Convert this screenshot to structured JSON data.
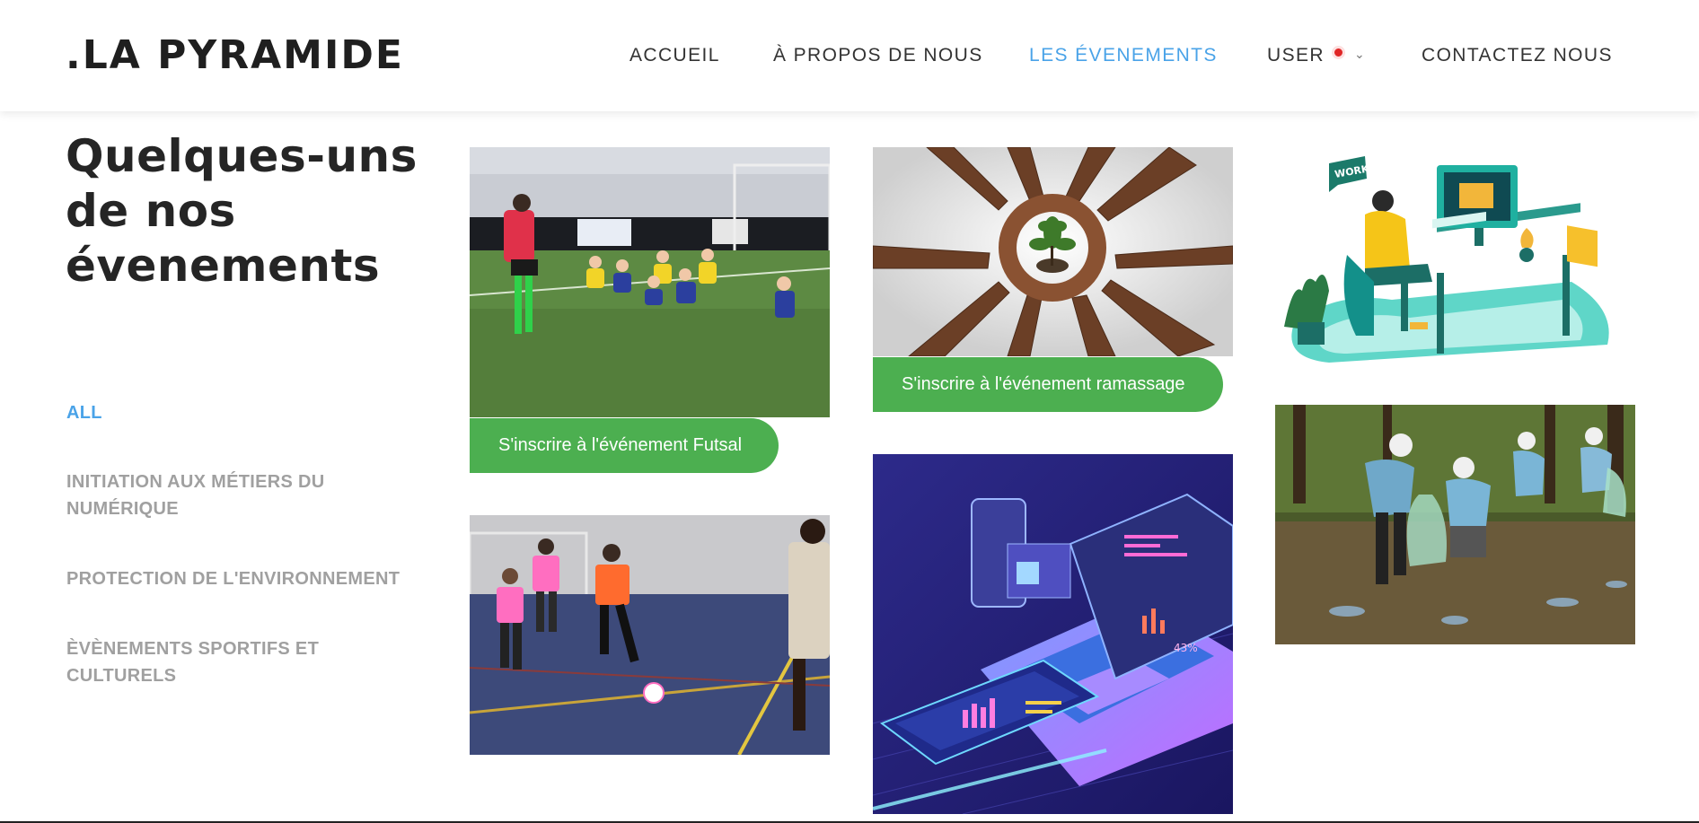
{
  "brand": {
    "logo": ".LA PYRAMIDE"
  },
  "nav": {
    "items": [
      {
        "label": "ACCUEIL",
        "active": false
      },
      {
        "label": "À PROPOS DE NOUS",
        "active": false
      },
      {
        "label": "LES ÉVENEMENTS",
        "active": true
      },
      {
        "label": "USER",
        "active": false,
        "status_dot_color": "#e02626"
      },
      {
        "label": "CONTACTEZ NOUS",
        "active": false
      }
    ]
  },
  "section": {
    "title": "Quelques-uns de nos évenements",
    "filters": [
      {
        "label": "ALL",
        "active": true
      },
      {
        "label": "INITIATION AUX MÉTIERS DU NUMÉRIQUE",
        "active": false
      },
      {
        "label": "PROTECTION DE L'ENVIRONNEMENT",
        "active": false
      },
      {
        "label": "ÈVÈNEMENTS SPORTIFS ET CULTURELS",
        "active": false
      }
    ]
  },
  "gallery": {
    "cards": [
      {
        "image_icon": "indoor-football-kids-photo",
        "button_label": "S'inscrire à l'événement Futsal"
      },
      {
        "image_icon": "hands-circle-plant-photo",
        "button_label": "S'inscrire à l'événement ramassage"
      },
      {
        "image_icon": "person-at-computer-illustration"
      },
      {
        "image_icon": "futsal-match-photo"
      },
      {
        "image_icon": "isometric-laptop-illustration"
      },
      {
        "image_icon": "volunteers-litter-pickup-photo"
      }
    ]
  },
  "colors": {
    "accent_blue": "#4aa3e8",
    "cta_green": "#4caf50",
    "filter_gray": "#a0a0a0",
    "user_dot_red": "#e02626"
  }
}
